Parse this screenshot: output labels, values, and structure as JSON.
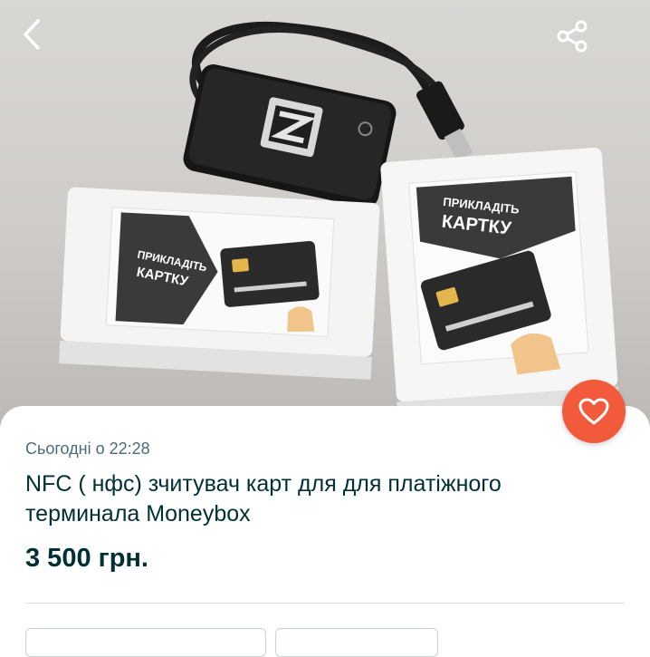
{
  "photo": {
    "alt_icons": [
      "back-arrow-icon",
      "share-icon"
    ]
  },
  "listing": {
    "timestamp": "Сьогодні о 22:28",
    "title": "NFC ( нфс) зчитувач карт для для платіжного терминала Moneybox",
    "price": "3 500 грн."
  },
  "box_left": {
    "label_line1": "ПРИКЛАДІТЬ",
    "label_line2": "КАРТКУ"
  },
  "box_right": {
    "label_line1": "ПРИКЛАДІТЬ",
    "label_line2": "КАРТКУ"
  },
  "colors": {
    "accent": "#f15a3b",
    "text": "#002f34",
    "muted": "#4a6b73"
  }
}
